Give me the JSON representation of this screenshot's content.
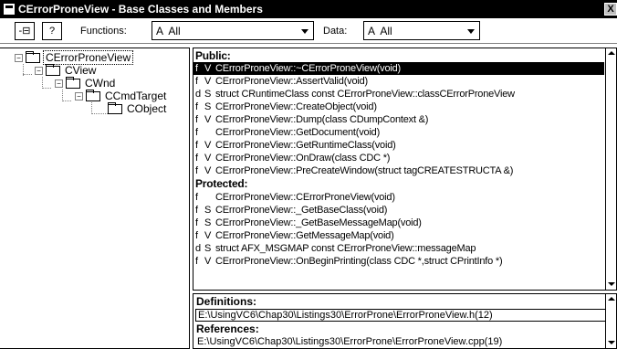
{
  "window": {
    "title": "CErrorProneView - Base Classes and Members",
    "close_glyph": "X"
  },
  "toolbar": {
    "pin_glyph": "-⊟",
    "help_glyph": "?",
    "functions_label": "Functions:",
    "functions_value": "A  All",
    "data_label": "Data:",
    "data_value": "A  All"
  },
  "tree": {
    "nodes": [
      {
        "label": "CErrorProneView",
        "expander": "−"
      },
      {
        "label": "CView",
        "expander": "−"
      },
      {
        "label": "CWnd",
        "expander": "−"
      },
      {
        "label": "CCmdTarget",
        "expander": "−"
      },
      {
        "label": "CObject",
        "expander": ""
      }
    ]
  },
  "members": {
    "public_header": "Public:",
    "protected_header": "Protected:",
    "public_rows": [
      {
        "kind": "f",
        "access": "V",
        "text": "CErrorProneView::~CErrorProneView(void)"
      },
      {
        "kind": "f",
        "access": "V",
        "text": "CErrorProneView::AssertValid(void)"
      },
      {
        "kind": "d",
        "access": "S",
        "text": "struct CRuntimeClass const  CErrorProneView::classCErrorProneView"
      },
      {
        "kind": "f",
        "access": "S",
        "text": "CErrorProneView::CreateObject(void)"
      },
      {
        "kind": "f",
        "access": "V",
        "text": "CErrorProneView::Dump(class CDumpContext &)"
      },
      {
        "kind": "f",
        "access": "",
        "text": "CErrorProneView::GetDocument(void)"
      },
      {
        "kind": "f",
        "access": "V",
        "text": "CErrorProneView::GetRuntimeClass(void)"
      },
      {
        "kind": "f",
        "access": "V",
        "text": "CErrorProneView::OnDraw(class CDC *)"
      },
      {
        "kind": "f",
        "access": "V",
        "text": "CErrorProneView::PreCreateWindow(struct tagCREATESTRUCTA &)"
      }
    ],
    "protected_rows": [
      {
        "kind": "f",
        "access": "",
        "text": "CErrorProneView::CErrorProneView(void)"
      },
      {
        "kind": "f",
        "access": "S",
        "text": "CErrorProneView::_GetBaseClass(void)"
      },
      {
        "kind": "f",
        "access": "S",
        "text": "CErrorProneView::_GetBaseMessageMap(void)"
      },
      {
        "kind": "f",
        "access": "V",
        "text": "CErrorProneView::GetMessageMap(void)"
      },
      {
        "kind": "d",
        "access": "S",
        "text": "struct AFX_MSGMAP const  CErrorProneView::messageMap"
      },
      {
        "kind": "f",
        "access": "V",
        "text": "CErrorProneView::OnBeginPrinting(class CDC *,struct CPrintInfo *)"
      }
    ]
  },
  "definitions": {
    "header": "Definitions:",
    "path": "E:\\UsingVC6\\Chap30\\Listings30\\ErrorProne\\ErrorProneView.h(12)"
  },
  "references": {
    "header": "References:",
    "path": "E:\\UsingVC6\\Chap30\\Listings30\\ErrorProne\\ErrorProneView.cpp(19)"
  }
}
